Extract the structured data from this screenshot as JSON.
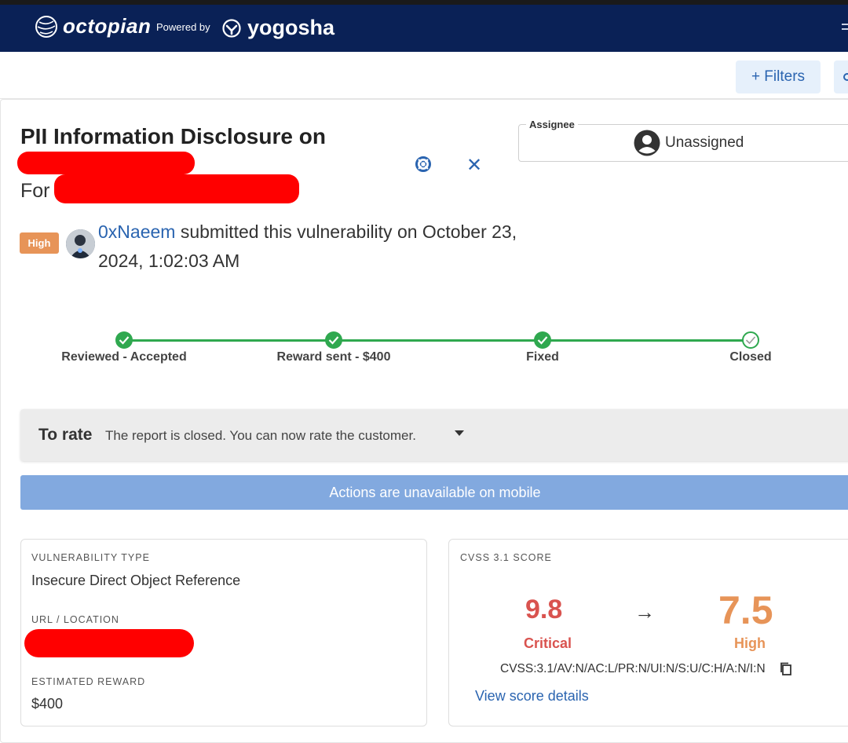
{
  "navbar": {
    "brand": "octopian",
    "powered_by": "Powered by",
    "partner": "yogosha"
  },
  "filters": {
    "label": "+ Filters"
  },
  "report": {
    "title": "PII Information Disclosure on",
    "for_label": "For",
    "severity": "High",
    "submitter": "0xNaeem",
    "submit_text": " submitted this vulnerability on October 23, 2024, 1:02:03 AM"
  },
  "assignee": {
    "legend": "Assignee",
    "value": "Unassigned"
  },
  "steps": [
    {
      "label": "Reviewed - Accepted",
      "status": "done"
    },
    {
      "label": "Reward sent - $400",
      "status": "done"
    },
    {
      "label": "Fixed",
      "status": "done"
    },
    {
      "label": "Closed",
      "status": "current"
    }
  ],
  "rating": {
    "title": "To rate",
    "text": "The report is closed. You can now rate the customer."
  },
  "actions_notice": "Actions are unavailable on mobile",
  "details": {
    "vuln_type_label": "VULNERABILITY TYPE",
    "vuln_type_value": "Insecure Direct Object Reference",
    "url_label": "URL / LOCATION",
    "reward_label": "ESTIMATED REWARD",
    "reward_value": "$400"
  },
  "cvss": {
    "label": "CVSS 3.1 SCORE",
    "original_score": "9.8",
    "original_rating": "Critical",
    "final_score": "7.5",
    "final_rating": "High",
    "vector": "CVSS:3.1/AV:N/AC:L/PR:N/UI:N/S:U/C:H/A:N/I:N",
    "details_link": "View score details"
  },
  "colors": {
    "navbar": "#0a2156",
    "accent_blue": "#2a64b0",
    "success_green": "#2fa84f",
    "critical_red": "#d9534f",
    "high_orange": "#e79458"
  }
}
